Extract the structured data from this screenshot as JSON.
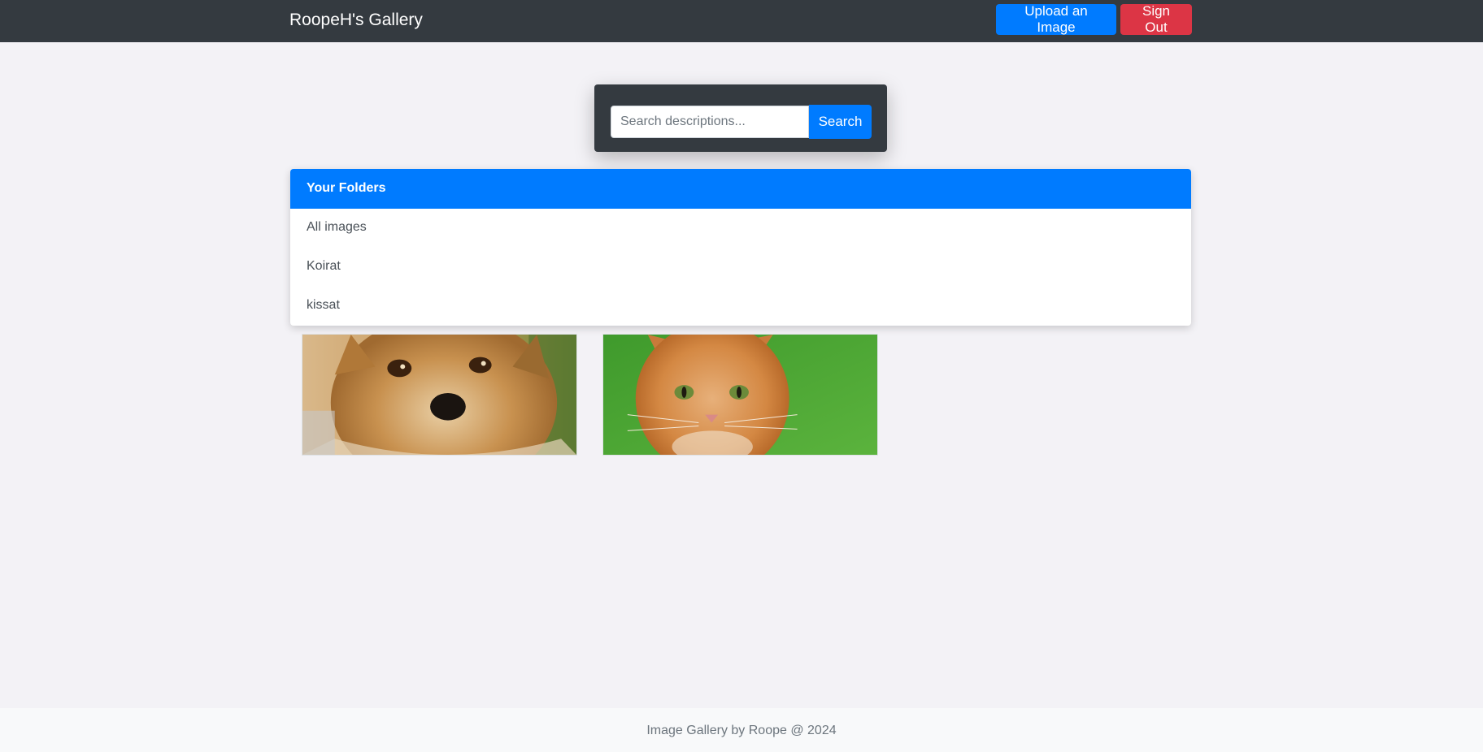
{
  "navbar": {
    "brand": "RoopeH's Gallery",
    "upload_label": "Upload an Image",
    "signout_label": "Sign Out"
  },
  "search": {
    "placeholder": "Search descriptions...",
    "value": "",
    "button_label": "Search"
  },
  "folders": {
    "title": "Your Folders",
    "items": [
      {
        "label": "All images"
      },
      {
        "label": "Koirat"
      },
      {
        "label": "kissat"
      }
    ]
  },
  "images": [
    {
      "subject": "dog-photo"
    },
    {
      "subject": "cat-photo"
    }
  ],
  "footer": {
    "text": "Image Gallery by Roope @ 2024"
  },
  "colors": {
    "navbar": "#343a40",
    "primary": "#007bff",
    "danger": "#dc3545",
    "background": "#f3f2f6"
  }
}
